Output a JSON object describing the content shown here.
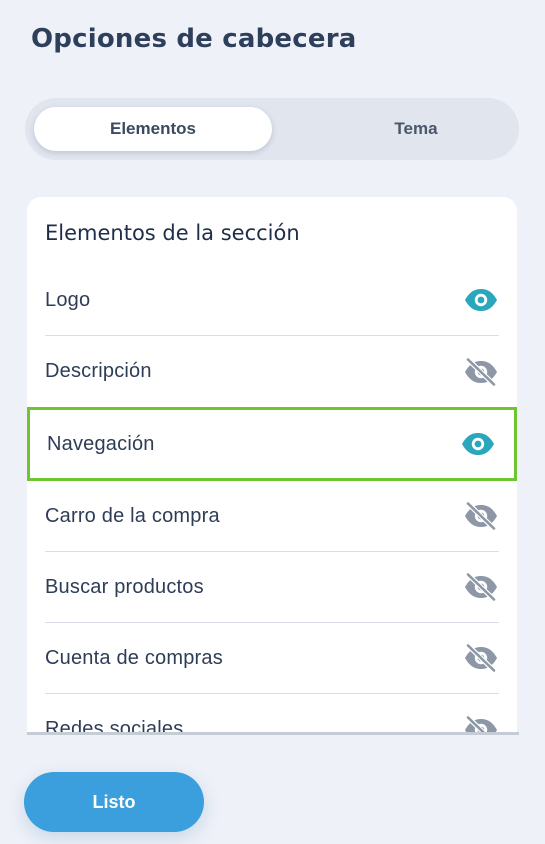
{
  "header": {
    "title": "Opciones de cabecera"
  },
  "tabs": [
    {
      "label": "Elementos",
      "active": true
    },
    {
      "label": "Tema",
      "active": false
    }
  ],
  "section": {
    "title": "Elementos de la sección",
    "items": [
      {
        "label": "Logo",
        "visible": true,
        "icon": "eye-icon"
      },
      {
        "label": "Descripción",
        "visible": false,
        "icon": "eye-off-icon"
      },
      {
        "label": "Navegación",
        "visible": true,
        "icon": "eye-icon",
        "highlighted": true
      },
      {
        "label": "Carro de la compra",
        "visible": false,
        "icon": "eye-off-icon"
      },
      {
        "label": "Buscar productos",
        "visible": false,
        "icon": "eye-off-icon"
      },
      {
        "label": "Cuenta de compras",
        "visible": false,
        "icon": "eye-off-icon"
      },
      {
        "label": "Redes sociales",
        "visible": false,
        "icon": "eye-off-icon"
      }
    ]
  },
  "footer": {
    "done_label": "Listo"
  },
  "colors": {
    "visible_icon": "#2aa6bd",
    "hidden_icon": "#8d97a6",
    "highlight_border": "#6ec52f",
    "primary_button": "#3a9fdc"
  }
}
